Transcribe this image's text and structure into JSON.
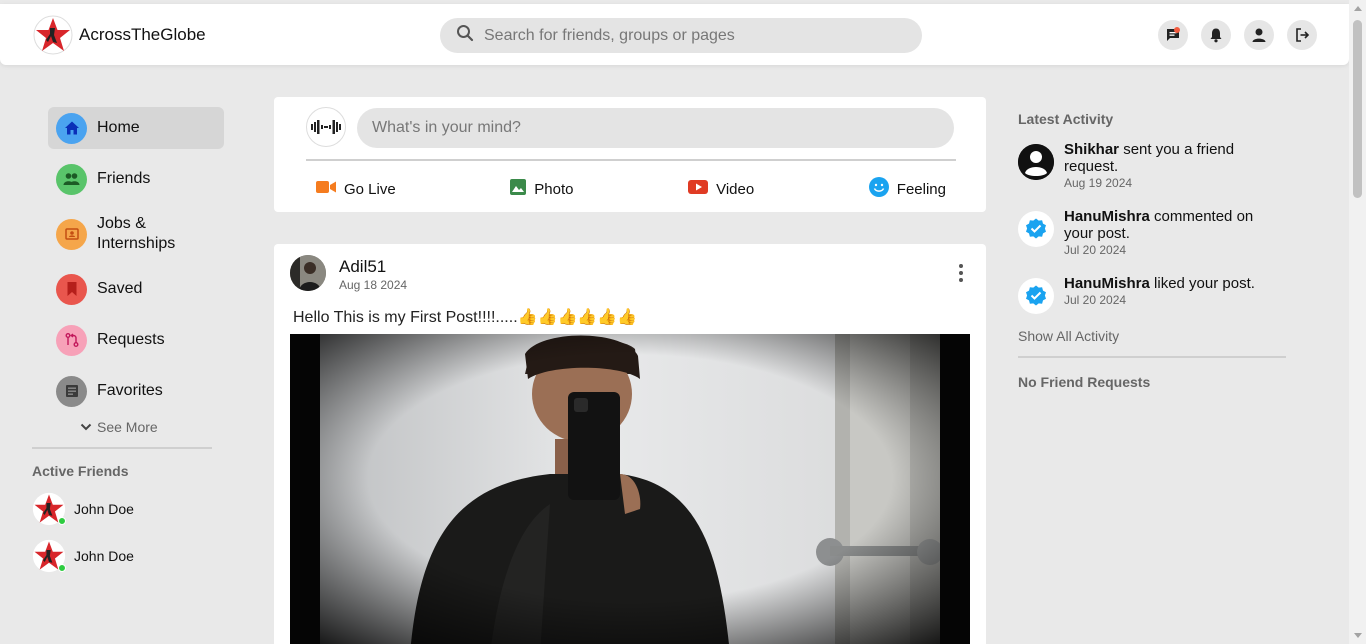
{
  "app": {
    "brand_name": "AcrossTheGlobe"
  },
  "header": {
    "search_placeholder": "Search for friends, groups or pages",
    "icons": [
      "messages-icon",
      "notifications-icon",
      "profile-icon",
      "logout-icon"
    ]
  },
  "sidebar": {
    "items": [
      {
        "label": "Home",
        "icon": "home-icon",
        "color": "#4aa3f0",
        "active": true
      },
      {
        "label": "Friends",
        "icon": "friends-icon",
        "color": "#59c46a"
      },
      {
        "label": "Jobs & Internships",
        "icon": "jobs-icon",
        "color": "#f5a64a"
      },
      {
        "label": "Saved",
        "icon": "bookmark-icon",
        "color": "#e9564d"
      },
      {
        "label": "Requests",
        "icon": "requests-icon",
        "color": "#f7a1b8"
      },
      {
        "label": "Favorites",
        "icon": "favorites-icon",
        "color": "#8a8a8a"
      }
    ],
    "see_more": "See More",
    "active_friends_title": "Active Friends",
    "active_friends": [
      {
        "name": "John Doe",
        "online": true
      },
      {
        "name": "John Doe",
        "online": true
      }
    ]
  },
  "composer": {
    "placeholder": "What's in your mind?",
    "actions": [
      {
        "label": "Go Live",
        "icon": "live-video-icon",
        "color": "#f57c1f"
      },
      {
        "label": "Photo",
        "icon": "photo-icon",
        "color": "#3b8a4a"
      },
      {
        "label": "Video",
        "icon": "youtube-icon",
        "color": "#e03b24"
      },
      {
        "label": "Feeling",
        "icon": "smile-icon",
        "color": "#1aa3f0"
      }
    ]
  },
  "post": {
    "author": "Adil51",
    "date": "Aug 18 2024",
    "text": "Hello This is my First Post!!!!.....👍👍👍👍👍👍"
  },
  "right": {
    "latest_activity_title": "Latest Activity",
    "activities": [
      {
        "user": "Shikhar",
        "action": " sent you a friend request.",
        "date": "Aug 19 2024",
        "icon": "user-avatar-icon"
      },
      {
        "user": "HanuMishra",
        "action": " commented on your post.",
        "date": "Jul 20 2024",
        "icon": "verified-icon"
      },
      {
        "user": "HanuMishra",
        "action": " liked your post.",
        "date": "Jul 20 2024",
        "icon": "verified-icon"
      }
    ],
    "show_all": "Show All Activity",
    "no_friend_requests": "No Friend Requests"
  },
  "colors": {
    "accent": "#1aa3f0",
    "brand_red": "#d8262b",
    "page_bg": "#e9e9e9"
  }
}
